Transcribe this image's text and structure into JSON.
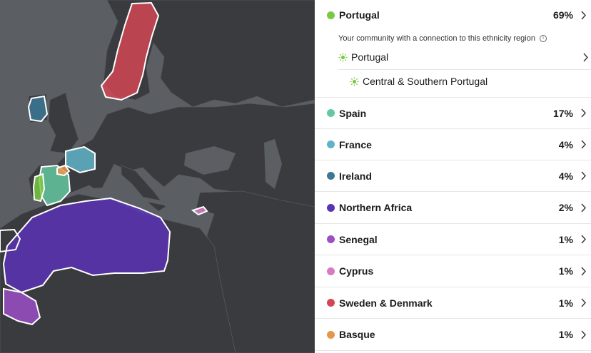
{
  "colors": {
    "portugal": "#7ac943",
    "spain": "#64c8a0",
    "france": "#5fb4c8",
    "ireland": "#3c7896",
    "northern_africa": "#5a32b4",
    "senegal": "#9b4fc4",
    "cyprus": "#d77ac3",
    "sweden_denmark": "#d24655",
    "basque": "#e6964b",
    "map_bg": "#5b5e63",
    "land": "#3a3b3f"
  },
  "top_region": {
    "name": "Portugal",
    "percent": "69%",
    "community_note": "Your community with a connection to this ethnicity region",
    "communities": [
      {
        "label": "Portugal"
      },
      {
        "label": "Central & Southern Portugal"
      }
    ]
  },
  "regions": [
    {
      "name": "Spain",
      "percent": "17%"
    },
    {
      "name": "France",
      "percent": "4%"
    },
    {
      "name": "Ireland",
      "percent": "4%"
    },
    {
      "name": "Northern Africa",
      "percent": "2%"
    },
    {
      "name": "Senegal",
      "percent": "1%"
    },
    {
      "name": "Cyprus",
      "percent": "1%"
    },
    {
      "name": "Sweden & Denmark",
      "percent": "1%"
    },
    {
      "name": "Basque",
      "percent": "1%"
    }
  ],
  "icons": {
    "chevron": "chevron-right-icon",
    "info": "info-icon",
    "community": "community-sunburst-icon"
  }
}
